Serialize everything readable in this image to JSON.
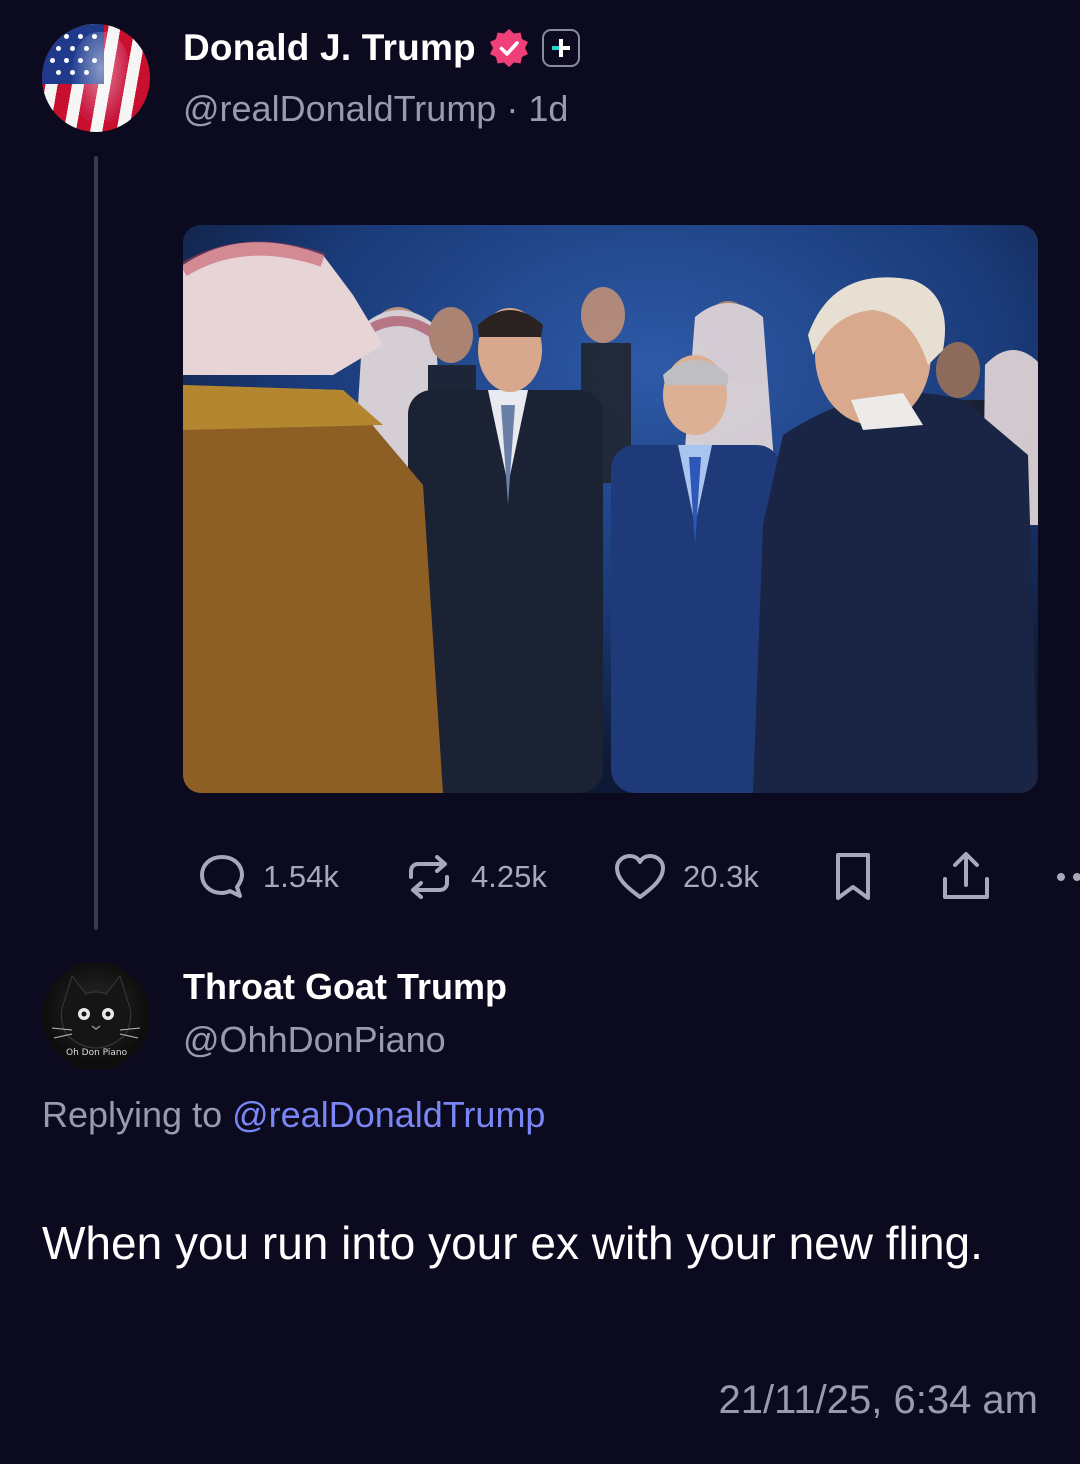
{
  "post": {
    "author": {
      "name": "Donald J. Trump",
      "handle": "@realDonaldTrump",
      "separator": "·",
      "age": "1d",
      "avatar_icon": "flag-portrait-avatar",
      "verified_icon": "verified-badge-icon",
      "verified_color": "#f0407a",
      "badge_icon": "plus-square-icon"
    },
    "image_description_icon": "photo",
    "stats": {
      "replies": "1.54k",
      "reposts": "4.25k",
      "likes": "20.3k"
    }
  },
  "reply": {
    "author": {
      "name": "Throat Goat Trump",
      "handle": "@OhhDonPiano",
      "avatar_caption": "Oh Don Piano"
    },
    "replying_prefix": "Replying to",
    "replying_to": "@realDonaldTrump",
    "text": "When you run into your ex with your new fling.",
    "timestamp": "21/11/25, 6:34 am"
  },
  "colors": {
    "background": "#0b0a1e",
    "secondary_text": "#9a99ad",
    "link": "#7b86f5",
    "thread_line": "#3a3852"
  }
}
